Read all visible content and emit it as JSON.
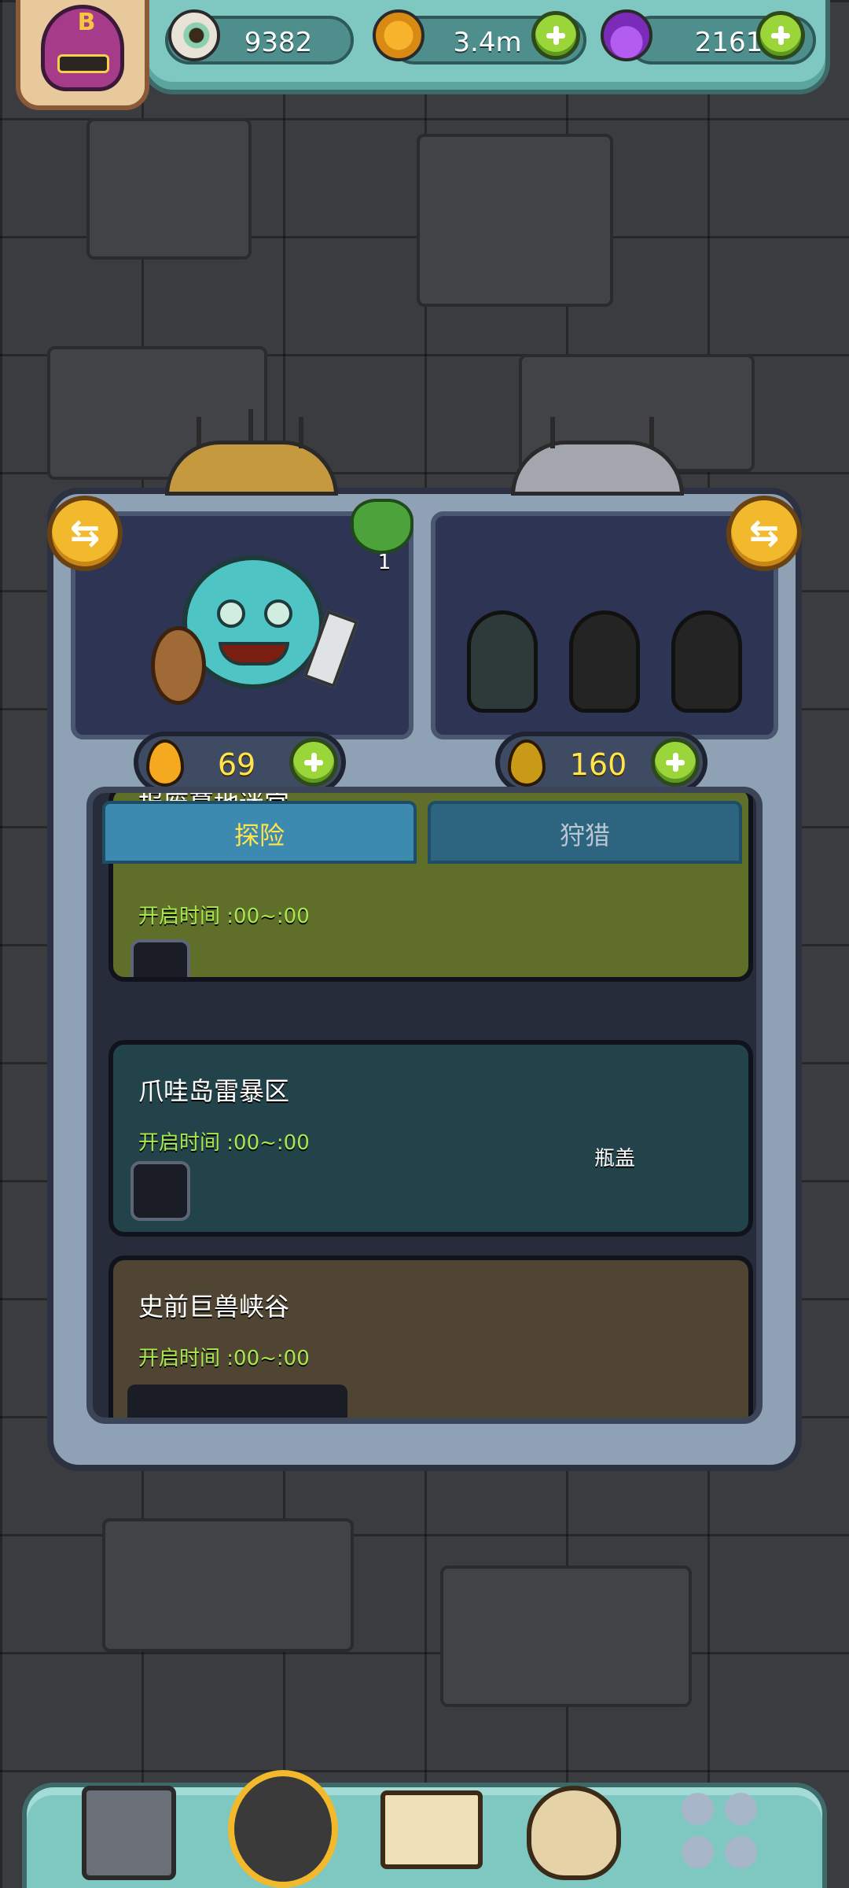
{
  "resources": {
    "eyeball_value": "9382",
    "coin_value": "3.4m",
    "potion_value": "2161"
  },
  "player": {
    "rank_letter": "B"
  },
  "party": {
    "clover_count": "1",
    "left_drop_value": "69",
    "right_drop_value": "160"
  },
  "tabs": [
    {
      "label": "探险",
      "active": true
    },
    {
      "label": "狩猎",
      "active": false
    }
  ],
  "stages": [
    {
      "title": "报废墓地迷宫",
      "time": "开启时间 :00~:00",
      "bg": "#5f6f2a"
    },
    {
      "title": "爪哇岛雷暴区",
      "time": "开启时间 :00~:00",
      "bg": "#23434a",
      "label": "瓶盖"
    },
    {
      "title": "史前巨兽峡谷",
      "time": "开启时间 :00~:00",
      "bg": "#4f4532"
    }
  ],
  "icons": {
    "eyeball": "eyeball-icon",
    "coin": "coin-icon",
    "potion": "potion-icon",
    "drop": "oil-drop-icon",
    "swap": "swap-arrows-icon",
    "clover": "clover-icon"
  },
  "nav": [
    "shop-building-icon",
    "hero-icon",
    "book-icon",
    "loot-bag-icon",
    "grid-menu-icon"
  ],
  "colors": {
    "accent_green": "#9ad63a",
    "gold": "#f2b92c",
    "time_green": "#a6e84d",
    "drop_yellow": "#ffe44d"
  }
}
